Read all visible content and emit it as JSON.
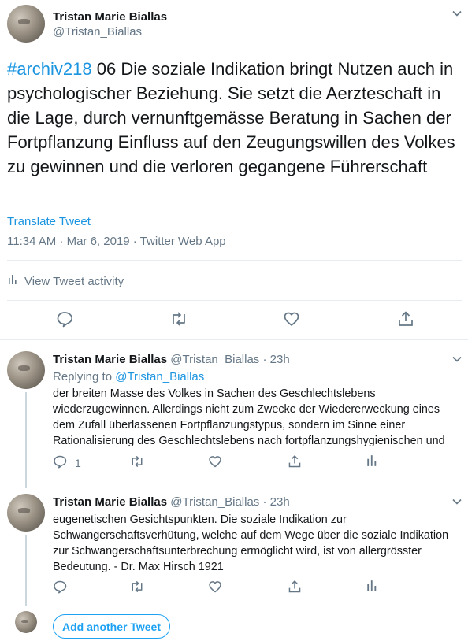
{
  "main_tweet": {
    "author_name": "Tristan Marie Biallas",
    "author_handle": "@Tristan_Biallas",
    "hashtag": "#archiv218",
    "text": " 06 Die soziale Indikation bringt Nutzen auch in psychologischer Beziehung. Sie setzt die Aerzteschaft in die Lage, durch vernunftgemässe Beratung in Sachen der Fortpflanzung Einfluss auf den Zeugungswillen des Volkes zu gewinnen und die verloren gegangene Führerschaft",
    "translate_label": "Translate Tweet",
    "meta": "11:34 AM · Mar 6, 2019 · Twitter Web App",
    "activity_label": "View Tweet activity"
  },
  "replies": [
    {
      "author_name": "Tristan Marie Biallas",
      "author_handle": "@Tristan_Biallas",
      "age": "· 23h",
      "replying_prefix": "Replying to ",
      "replying_handle": "@Tristan_Biallas",
      "text": "der breiten Masse des Volkes in Sachen des Geschlechtslebens wiederzugewinnen. Allerdings nicht zum Zwecke der Wiedererweckung eines dem Zufall überlassenen Fortpflanzungstypus, sondern im Sinne einer Rationalisierung des Geschlechtslebens nach fortpflanzungshygienischen und",
      "reply_count": "1"
    },
    {
      "author_name": "Tristan Marie Biallas",
      "author_handle": "@Tristan_Biallas",
      "age": "· 23h",
      "text": "eugenetischen Gesichtspunkten. Die soziale Indikation zur Schwangerschaftsverhütung, welche auf dem Wege über die soziale Indikation zur Schwangerschaftsunterbrechung ermöglicht wird, ist von allergrösster Bedeutung. - Dr. Max Hirsch 1921",
      "reply_count": ""
    }
  ],
  "compose": {
    "add_button_label": "Add another Tweet"
  },
  "icons": {
    "reply": "reply-icon",
    "retweet": "retweet-icon",
    "like": "like-icon",
    "share": "share-icon",
    "analytics": "analytics-icon",
    "caret": "chevron-down-icon"
  },
  "colors": {
    "link": "#1b95e0",
    "secondary_text": "#657786",
    "divider": "#e6ecf0",
    "thread_line": "#ccd6dd",
    "accent": "#1da1f2"
  }
}
